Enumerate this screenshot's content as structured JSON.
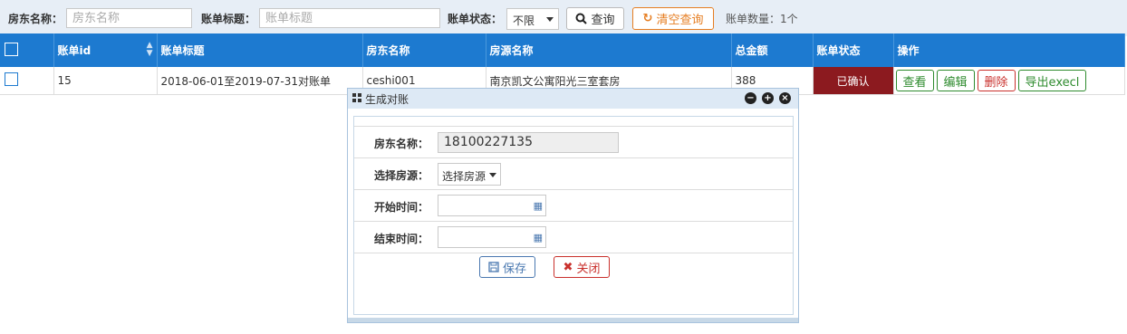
{
  "toolbar": {
    "landlord_label": "房东名称：",
    "landlord_placeholder": "房东名称",
    "title_label": "账单标题：",
    "title_placeholder": "账单标题",
    "status_label": "账单状态：",
    "status_value": "不限",
    "query_label": "查询",
    "clear_label": "清空查询",
    "count_text": "账单数量：1个"
  },
  "table": {
    "headers": [
      "账单id",
      "账单标题",
      "房东名称",
      "房源名称",
      "总金额",
      "账单状态",
      "操作"
    ],
    "rows": [
      {
        "id": "15",
        "title": "2018-06-01至2019-07-31对账单",
        "landlord": "ceshi001",
        "property": "南京凯文公寓阳光三室套房",
        "amount": "388",
        "status": "已确认",
        "actions": [
          "查看",
          "编辑",
          "删除",
          "导出execl"
        ]
      }
    ]
  },
  "dialog": {
    "title": "生成对账",
    "landlord_label": "房东名称：",
    "landlord_value": "18100227135",
    "property_label": "选择房源：",
    "property_value": "选择房源",
    "start_label": "开始时间：",
    "end_label": "结束时间：",
    "save_label": "保存",
    "close_label": "关闭"
  },
  "colors": {
    "header_blue": "#1d7ad0",
    "status_red": "#8c1a1f",
    "action_green": "#2e8b2e",
    "action_red": "#c9302c",
    "clear_orange": "#e67e22"
  },
  "icons": [
    "search-icon",
    "refresh-icon",
    "sort-icon",
    "grid-icon",
    "minimize-icon",
    "maximize-icon",
    "close-icon",
    "calendar-icon",
    "save-icon",
    "x-icon"
  ]
}
